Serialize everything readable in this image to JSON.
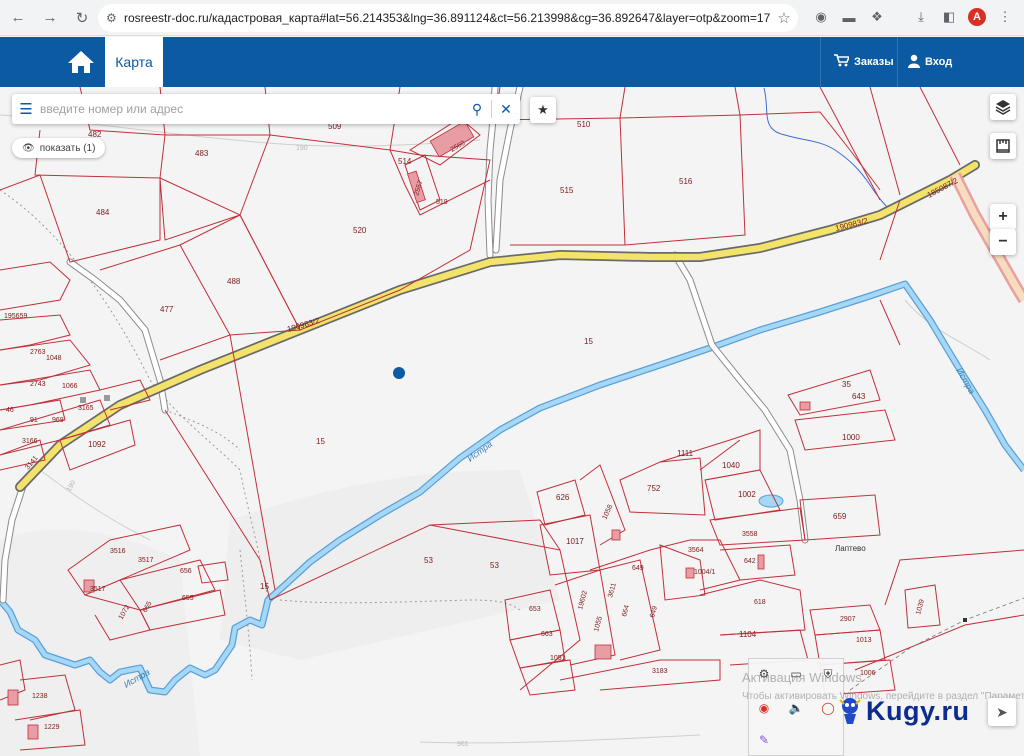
{
  "browser": {
    "url": "rosreestr-doc.ru/кадастровая_карта#lat=56.214353&lng=36.891124&ct=56.213998&cg=36.892647&layer=otp&zoom=17",
    "profile_initial": "A"
  },
  "header": {
    "tab_label": "Карта",
    "orders_label": "Заказы",
    "login_label": "Вход",
    "accent_color": "#0b5aa2"
  },
  "search": {
    "placeholder": "введите номер или адрес",
    "show_label": "показать (1)"
  },
  "map": {
    "parcel_labels": [
      "482",
      "483",
      "509",
      "510",
      "514",
      "2560",
      "2557",
      "519",
      "520",
      "515",
      "516",
      "484",
      "488",
      "477",
      "190983/2",
      "185087/2",
      "195659",
      "2763",
      "1048",
      "2743",
      "1066",
      "3165",
      "91",
      "969",
      "3166",
      "46",
      "3141",
      "1092",
      "15",
      "53",
      "626",
      "1058",
      "1017",
      "752",
      "1111",
      "1040",
      "1002",
      "35",
      "643",
      "1000",
      "659",
      "3516",
      "3517",
      "656",
      "655",
      "665",
      "1072",
      "3564",
      "3558",
      "642",
      "1004/1",
      "618",
      "653",
      "663",
      "1051",
      "19602",
      "1055",
      "3611",
      "664",
      "649",
      "1104",
      "2907",
      "1013",
      "1006",
      "1039",
      "1238",
      "1229",
      "3183",
      "Лаптево",
      "190",
      "961"
    ],
    "river_name": "Истра",
    "locality": "Лаптево",
    "route_color": "#f3e36b",
    "parcel_color": "#c0303a",
    "river_color": "#8ecbee"
  },
  "overlay": {
    "windows_title": "Активация Windows",
    "windows_sub": "Чтобы активировать Windows, перейдите в раздел \"Параметры\".",
    "watermark": "Kugy.ru"
  }
}
